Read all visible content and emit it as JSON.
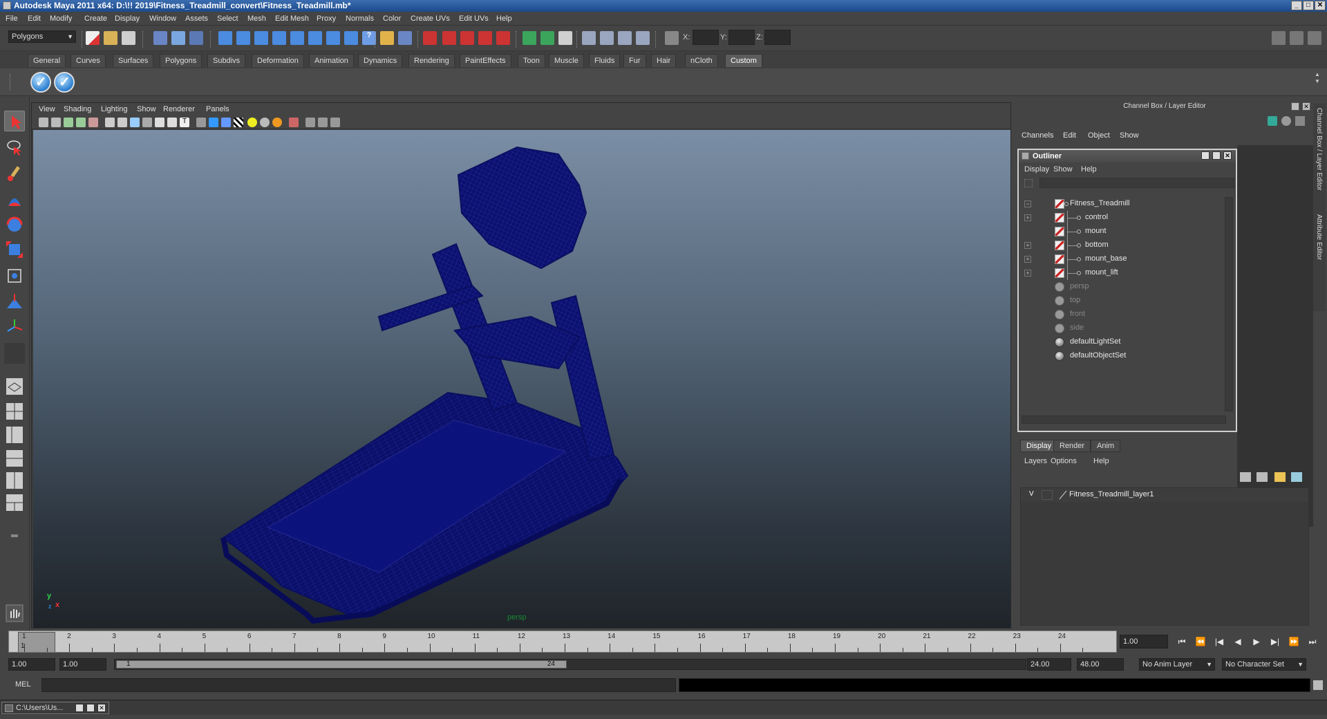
{
  "window": {
    "title": "Autodesk Maya 2011 x64: D:\\!! 2019\\Fitness_Treadmill_convert\\Fitness_Treadmill.mb*",
    "minimize": "_",
    "maximize": "□",
    "close": "✕"
  },
  "menubar": [
    "File",
    "Edit",
    "Modify",
    "Create",
    "Display",
    "Window",
    "Assets",
    "Select",
    "Mesh",
    "Edit Mesh",
    "Proxy",
    "Normals",
    "Color",
    "Create UVs",
    "Edit UVs",
    "Help"
  ],
  "statusline": {
    "menuset": "Polygons",
    "x_label": "X:",
    "y_label": "Y:",
    "z_label": "Z:"
  },
  "shelf": {
    "tabs": [
      "General",
      "Curves",
      "Surfaces",
      "Polygons",
      "Subdivs",
      "Deformation",
      "Animation",
      "Dynamics",
      "Rendering",
      "PaintEffects",
      "Toon",
      "Muscle",
      "Fluids",
      "Fur",
      "Hair",
      "nCloth",
      "Custom"
    ],
    "active_tab": "Custom"
  },
  "viewport": {
    "menu": [
      "View",
      "Shading",
      "Lighting",
      "Show",
      "Renderer",
      "Panels"
    ],
    "camera_label": "persp",
    "axis_y": "y",
    "axis_x": "x",
    "axis_z": "z",
    "wire_color": "#0a0f6e"
  },
  "channel_box": {
    "header": "Channel Box / Layer Editor",
    "menu": [
      "Channels",
      "Edit",
      "Object",
      "Show"
    ]
  },
  "outliner": {
    "title": "Outliner",
    "menu": [
      "Display",
      "Show",
      "Help"
    ],
    "items": [
      {
        "label": "Fitness_Treadmill",
        "icon": "mesh-icon",
        "expander": "−",
        "depth": 0,
        "dim": false
      },
      {
        "label": "control",
        "icon": "mesh-icon",
        "expander": "+",
        "depth": 1,
        "dim": false
      },
      {
        "label": "mount",
        "icon": "mesh-icon",
        "expander": "",
        "depth": 1,
        "dim": false
      },
      {
        "label": "bottom",
        "icon": "mesh-icon",
        "expander": "+",
        "depth": 1,
        "dim": false
      },
      {
        "label": "mount_base",
        "icon": "mesh-icon",
        "expander": "+",
        "depth": 1,
        "dim": false
      },
      {
        "label": "mount_lift",
        "icon": "mesh-icon",
        "expander": "+",
        "depth": 1,
        "dim": false
      },
      {
        "label": "persp",
        "icon": "camera-icon",
        "expander": "",
        "depth": 0,
        "dim": true
      },
      {
        "label": "top",
        "icon": "camera-icon",
        "expander": "",
        "depth": 0,
        "dim": true
      },
      {
        "label": "front",
        "icon": "camera-icon",
        "expander": "",
        "depth": 0,
        "dim": true
      },
      {
        "label": "side",
        "icon": "camera-icon",
        "expander": "",
        "depth": 0,
        "dim": true
      },
      {
        "label": "defaultLightSet",
        "icon": "set-icon",
        "expander": "",
        "depth": 0,
        "dim": false
      },
      {
        "label": "defaultObjectSet",
        "icon": "set-icon",
        "expander": "",
        "depth": 0,
        "dim": false
      }
    ]
  },
  "layer_editor": {
    "tabs": [
      "Display",
      "Render",
      "Anim"
    ],
    "active_tab": "Display",
    "menu": [
      "Layers",
      "Options",
      "Help"
    ],
    "layers": [
      {
        "visible": "V",
        "name": "Fitness_Treadmill_layer1"
      }
    ]
  },
  "side_tabs": [
    "Channel Box / Layer Editor",
    "Attribute Editor"
  ],
  "timeline": {
    "ticks": [
      "1",
      "2",
      "3",
      "4",
      "5",
      "6",
      "7",
      "8",
      "9",
      "10",
      "11",
      "12",
      "13",
      "14",
      "15",
      "16",
      "17",
      "18",
      "19",
      "20",
      "21",
      "22",
      "23",
      "24"
    ],
    "current_marker": "1",
    "current_time": "1.00"
  },
  "playback": {
    "buttons": [
      "⏮",
      "⏪",
      "|◀",
      "◀",
      "▶",
      "▶|",
      "⏩",
      "⏭"
    ]
  },
  "range": {
    "start_time": "1.00",
    "playback_start": "1.00",
    "thumb_start": "1",
    "thumb_end": "24",
    "playback_end": "24.00",
    "end_time": "48.00",
    "anim_layer": "No Anim Layer",
    "character_set": "No Character Set"
  },
  "command_line": {
    "label": "MEL"
  },
  "taskbar": {
    "item": "C:\\Users\\Us..."
  }
}
